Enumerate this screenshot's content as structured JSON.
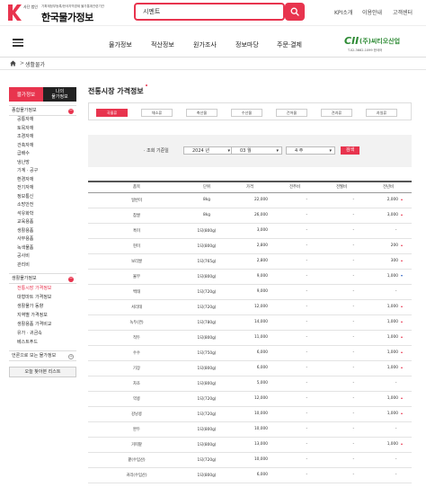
{
  "header": {
    "logo_sub": "기획재정부등록/한국지역경제 물가통계관련기관",
    "logo_small": "사단 법인",
    "logo_name": "한국물가정보",
    "search_value": "시멘트",
    "links": [
      "KPI소개",
      "이용안내",
      "고객센터"
    ]
  },
  "nav": {
    "items": [
      "물가정보",
      "적산정보",
      "원가조사",
      "정보마당",
      "주문·결제"
    ]
  },
  "partner": {
    "mark": "CII",
    "name": "(주)씨티오산업",
    "tel": "T.02-3662-1099    한국어"
  },
  "breadcrumb": {
    "sep": ">",
    "current": "생활물가"
  },
  "sidebar": {
    "tab_active": "물가정보",
    "tab_other": "나의\n물가정보",
    "group1": {
      "label": "종합물가정보",
      "toggle": "−"
    },
    "group1_items": [
      "공통자재",
      "토목자재",
      "조경자재",
      "건축자재",
      "급배수",
      "냉난방",
      "기계 · 공구",
      "환경자재",
      "전기자재",
      "정보통신",
      "소방안전",
      "석유화학",
      "교육용품",
      "생활용품",
      "사무용품",
      "녹색물품",
      "공사비",
      "관리비"
    ],
    "group2": {
      "label": "생활물가정보",
      "toggle": "−"
    },
    "group2_items": [
      "전통시장 가격정보",
      "대형마트 가격정보",
      "생활물가 동향",
      "지역별 가격정보",
      "생활용품 가격비교",
      "유가 · 귀금속",
      "베스트푸드"
    ],
    "group3": {
      "label": "언론으로 보는 물가정보",
      "toggle": "+"
    },
    "recent_btn": "오늘 찾아본 리스트"
  },
  "main": {
    "title": "전통시장 가격정보",
    "category_tabs": [
      "곡물류",
      "채소류",
      "축산물",
      "수산물",
      "건어물",
      "견과류",
      "과일류"
    ],
    "filter": {
      "label": "· 조회 기준일",
      "year": "2024 년",
      "month": "03 월",
      "week": "4 주",
      "button": "검색"
    },
    "table": {
      "headers": [
        "품목",
        "단위",
        "가격",
        "전주비",
        "전월비",
        "전년비"
      ],
      "rows": [
        {
          "item": "일반미",
          "unit": "8kg",
          "price": "22,000",
          "d1": "-",
          "d2": "-",
          "d3": "2,000",
          "dir": "up"
        },
        {
          "item": "찹쌀",
          "unit": "8kg",
          "price": "26,000",
          "d1": "-",
          "d2": "-",
          "d3": "3,000",
          "dir": "up"
        },
        {
          "item": "흑미",
          "unit": "1되(800g)",
          "price": "3,000",
          "d1": "-",
          "d2": "-",
          "d3": "-",
          "dir": "none"
        },
        {
          "item": "현미",
          "unit": "1되(800g)",
          "price": "2,800",
          "d1": "-",
          "d2": "-",
          "d3": "200",
          "dir": "up"
        },
        {
          "item": "보리쌀",
          "unit": "1되(765g)",
          "price": "2,800",
          "d1": "-",
          "d2": "-",
          "d3": "300",
          "dir": "up"
        },
        {
          "item": "율무",
          "unit": "1되(800g)",
          "price": "9,000",
          "d1": "-",
          "d2": "-",
          "d3": "1,000",
          "dir": "down"
        },
        {
          "item": "백태",
          "unit": "1되(720g)",
          "price": "9,000",
          "d1": "-",
          "d2": "-",
          "d3": "-",
          "dir": "none"
        },
        {
          "item": "서리태",
          "unit": "1되(720g)",
          "price": "12,000",
          "d1": "-",
          "d2": "-",
          "d3": "1,000",
          "dir": "up"
        },
        {
          "item": "녹두(깐)",
          "unit": "1되(780g)",
          "price": "14,000",
          "d1": "-",
          "d2": "-",
          "d3": "1,000",
          "dir": "up"
        },
        {
          "item": "적두",
          "unit": "1되(800g)",
          "price": "11,000",
          "d1": "-",
          "d2": "-",
          "d3": "1,000",
          "dir": "up"
        },
        {
          "item": "수수",
          "unit": "1되(750g)",
          "price": "6,000",
          "d1": "-",
          "d2": "-",
          "d3": "1,000",
          "dir": "up"
        },
        {
          "item": "기장",
          "unit": "1되(800g)",
          "price": "6,000",
          "d1": "-",
          "d2": "-",
          "d3": "1,000",
          "dir": "up"
        },
        {
          "item": "차조",
          "unit": "1되(800g)",
          "price": "5,000",
          "d1": "-",
          "d2": "-",
          "d3": "-",
          "dir": "none"
        },
        {
          "item": "약콩",
          "unit": "1되(720g)",
          "price": "12,000",
          "d1": "-",
          "d2": "-",
          "d3": "1,000",
          "dir": "up"
        },
        {
          "item": "강낭콩",
          "unit": "1되(720g)",
          "price": "10,000",
          "d1": "-",
          "d2": "-",
          "d3": "1,000",
          "dir": "up"
        },
        {
          "item": "완두",
          "unit": "1되(800g)",
          "price": "10,000",
          "d1": "-",
          "d2": "-",
          "d3": "-",
          "dir": "none"
        },
        {
          "item": "거피팥",
          "unit": "1되(800g)",
          "price": "13,000",
          "d1": "-",
          "d2": "-",
          "d3": "1,000",
          "dir": "up"
        },
        {
          "item": "팥(수입산)",
          "unit": "1되(720g)",
          "price": "10,000",
          "d1": "-",
          "d2": "-",
          "d3": "-",
          "dir": "none"
        },
        {
          "item": "귀리(수입산)",
          "unit": "1되(800g)",
          "price": "6,000",
          "d1": "-",
          "d2": "-",
          "d3": "-",
          "dir": "none"
        }
      ]
    }
  },
  "colors": {
    "accent": "#e8344e",
    "partner": "#2d8a34",
    "down": "#2a5fc4"
  },
  "icons": [
    "search-icon",
    "home-icon",
    "menu-icon",
    "chevron-down-icon",
    "arrow-up-icon",
    "arrow-down-icon",
    "collapse-icon",
    "expand-icon"
  ]
}
